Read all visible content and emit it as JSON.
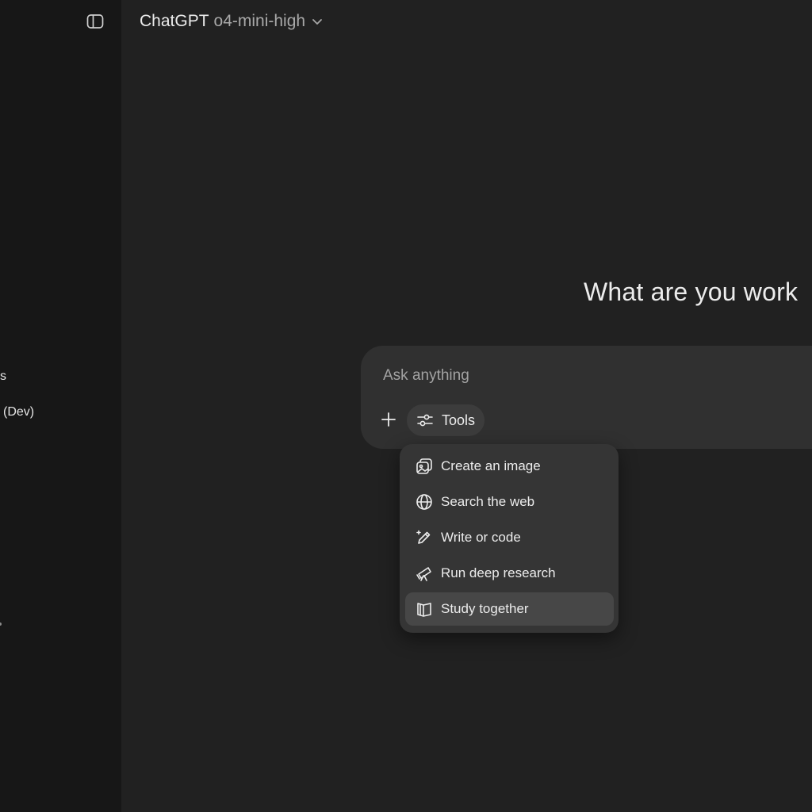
{
  "sidebar": {
    "items": [
      {
        "label": "vs"
      },
      {
        "label": "(Dev)"
      }
    ]
  },
  "header": {
    "brand": "ChatGPT",
    "model": "o4-mini-high"
  },
  "main": {
    "headline": "What are you work"
  },
  "composer": {
    "placeholder": "Ask anything",
    "value": "",
    "tools_label": "Tools"
  },
  "tools_menu": {
    "items": [
      {
        "label": "Create an image",
        "icon": "image-icon"
      },
      {
        "label": "Search the web",
        "icon": "globe-icon"
      },
      {
        "label": "Write or code",
        "icon": "pencil-icon"
      },
      {
        "label": "Run deep research",
        "icon": "telescope-icon"
      },
      {
        "label": "Study together",
        "icon": "book-icon",
        "highlighted": true
      }
    ]
  },
  "colors": {
    "background": "#212121",
    "sidebar": "#171717",
    "composer": "#303030",
    "menu": "#353535",
    "menu_highlight": "#474747",
    "text": "#ececec",
    "muted_text": "#a8a8a8"
  }
}
